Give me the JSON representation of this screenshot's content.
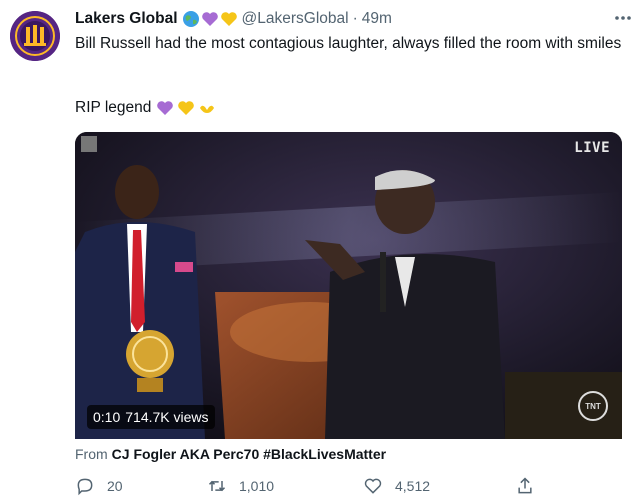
{
  "tweet": {
    "display_name": "Lakers Global",
    "handle": "@LakersGlobal",
    "separator": "·",
    "time": "49m",
    "text": "Bill Russell had the most contagious laughter, always filled the room with smiles",
    "rip_text": "RIP legend",
    "badges": [
      "globe-emoji",
      "purple-heart-emoji",
      "yellow-heart-emoji"
    ],
    "rip_emojis": [
      "purple-heart-emoji",
      "yellow-heart-emoji",
      "yellow-heart-hands-emoji"
    ]
  },
  "video": {
    "live_label": "LIVE",
    "elapsed": "0:10",
    "views": "714.7K views",
    "watermark": "TNT"
  },
  "source": {
    "prefix": "From",
    "name": "CJ Fogler AKA Perc70 #BlackLivesMatter"
  },
  "actions": {
    "reply_count": "20",
    "retweet_count": "1,010",
    "like_count": "4,512"
  },
  "colors": {
    "text": "#0f1419",
    "secondary": "#536471",
    "lakers_purple": "#552583",
    "lakers_gold": "#fdb927"
  }
}
